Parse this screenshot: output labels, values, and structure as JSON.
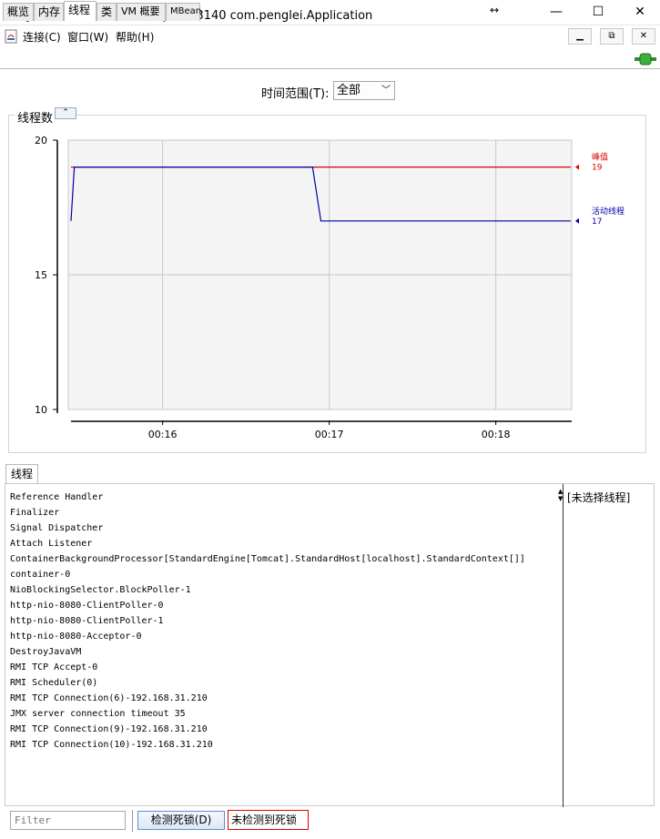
{
  "window": {
    "title": "Java 监视和管理控制台 - pid: 13140 com.penglei.Application",
    "minimize_glyph": "—",
    "maximize_glyph": "☐",
    "close_glyph": "✕"
  },
  "menu": {
    "items": [
      "连接(C)",
      "窗口(W)",
      "帮助(H)"
    ],
    "mdi_buttons": [
      "▁",
      "⧉",
      "✕"
    ]
  },
  "tabs": [
    "概览",
    "内存",
    "线程",
    "类",
    "VM 概要",
    "MBean"
  ],
  "active_tab": "线程",
  "time_range": {
    "label": "时间范围(T):",
    "value": "全部"
  },
  "chart_panel": {
    "title": "线程数",
    "collapse_glyph": "⌃"
  },
  "chart_data": {
    "type": "line",
    "title": "线程数",
    "ylim": [
      10,
      20
    ],
    "y_ticks": [
      10,
      15,
      20
    ],
    "x_ticks": [
      "00:16",
      "00:17",
      "00:18"
    ],
    "grid": true,
    "series": [
      {
        "name": "峰值",
        "color": "#dd0000",
        "current_value": "19",
        "points": [
          [
            0,
            19
          ],
          [
            1,
            19
          ],
          [
            2,
            19
          ],
          [
            3,
            19
          ]
        ]
      },
      {
        "name": "活动线程",
        "color": "#0000aa",
        "current_value": "17",
        "points": [
          [
            0,
            17
          ],
          [
            0.02,
            19
          ],
          [
            1.45,
            19
          ],
          [
            1.5,
            17
          ],
          [
            3,
            17
          ]
        ]
      }
    ]
  },
  "threads_section": {
    "tab_label": "线程",
    "list": [
      "Reference Handler",
      "Finalizer",
      "Signal Dispatcher",
      "Attach Listener",
      "ContainerBackgroundProcessor[StandardEngine[Tomcat].StandardHost[localhost].StandardContext[]]",
      "container-0",
      "NioBlockingSelector.BlockPoller-1",
      "http-nio-8080-ClientPoller-0",
      "http-nio-8080-ClientPoller-1",
      "http-nio-8080-Acceptor-0",
      "DestroyJavaVM",
      "RMI TCP Accept-0",
      "RMI Scheduler(0)",
      "RMI TCP Connection(6)-192.168.31.210",
      "JMX server connection timeout 35",
      "RMI TCP Connection(9)-192.168.31.210",
      "RMI TCP Connection(10)-192.168.31.210"
    ],
    "no_selection": "[未选择线程]",
    "filter_placeholder": "Filter",
    "detect_button": "检测死锁(D)",
    "status": "未检测到死锁"
  },
  "colors": {
    "peak": "#dd0000",
    "live": "#0000aa",
    "status_border": "#dd0000"
  }
}
